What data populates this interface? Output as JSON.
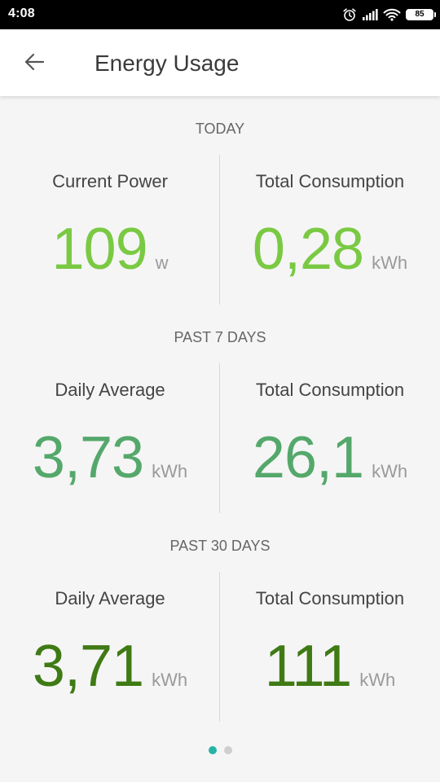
{
  "status_bar": {
    "time": "4:08",
    "battery": "85"
  },
  "app_bar": {
    "title": "Energy Usage"
  },
  "sections": [
    {
      "header": "TODAY",
      "color": "#7ac943",
      "left": {
        "label": "Current Power",
        "value": "109",
        "unit": "w"
      },
      "right": {
        "label": "Total Consumption",
        "value": "0,28",
        "unit": "kWh"
      }
    },
    {
      "header": "PAST 7 DAYS",
      "color": "#55a86b",
      "left": {
        "label": "Daily Average",
        "value": "3,73",
        "unit": "kWh"
      },
      "right": {
        "label": "Total Consumption",
        "value": "26,1",
        "unit": "kWh"
      }
    },
    {
      "header": "PAST 30 DAYS",
      "color": "#3f7a14",
      "left": {
        "label": "Daily Average",
        "value": "3,71",
        "unit": "kWh"
      },
      "right": {
        "label": "Total Consumption",
        "value": "111",
        "unit": "kWh"
      }
    }
  ],
  "page_indicator": {
    "active_index": 0,
    "count": 2,
    "active_color": "#26b3a8",
    "inactive_color": "#cfcfcf"
  }
}
